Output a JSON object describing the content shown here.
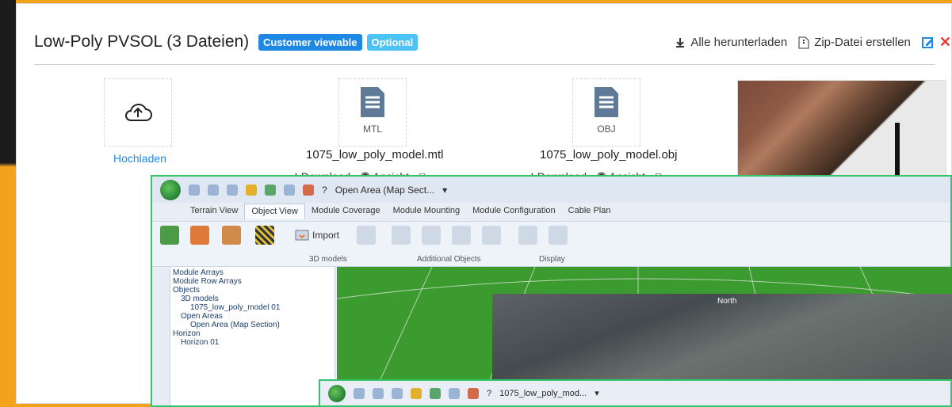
{
  "header": {
    "title": "Low-Poly PVSOL (3 Dateien)",
    "badges": [
      "Customer viewable",
      "Optional"
    ],
    "actions": {
      "download_all": "Alle herunterladen",
      "create_zip": "Zip-Datei erstellen"
    }
  },
  "upload": {
    "label": "Hochladen"
  },
  "files": [
    {
      "ext": "MTL",
      "name": "1075_low_poly_model.mtl",
      "actions": "Download - ◉ Ansicht - ⧉"
    },
    {
      "ext": "OBJ",
      "name": "1075_low_poly_model.obj",
      "actions": "Download - ◉ Ansicht - ⧉"
    }
  ],
  "app": {
    "quickaccess_label": "Open Area (Map Sect...",
    "tabs": [
      "Terrain View",
      "Object View",
      "Module Coverage",
      "Module Mounting",
      "Module Configuration",
      "Cable Plan"
    ],
    "ribbon": {
      "import_label": "Import",
      "groups": [
        "3D models",
        "Additional Objects",
        "Display"
      ]
    },
    "tree": [
      "Module Arrays",
      "Module Row Arrays",
      "Objects",
      "3D models",
      "1075_low_poly_model 01",
      "Open Areas",
      "Open Area (Map Section)",
      "Horizon",
      "Horizon 01"
    ],
    "map_label": "North"
  },
  "app2": {
    "label": "1075_low_poly_mod..."
  },
  "colors": {
    "badge_blue": "#1e88e5",
    "badge_cyan": "#4cc3f5",
    "accent_green_border": "#34c56a",
    "background_orange": "#f2a21b"
  }
}
